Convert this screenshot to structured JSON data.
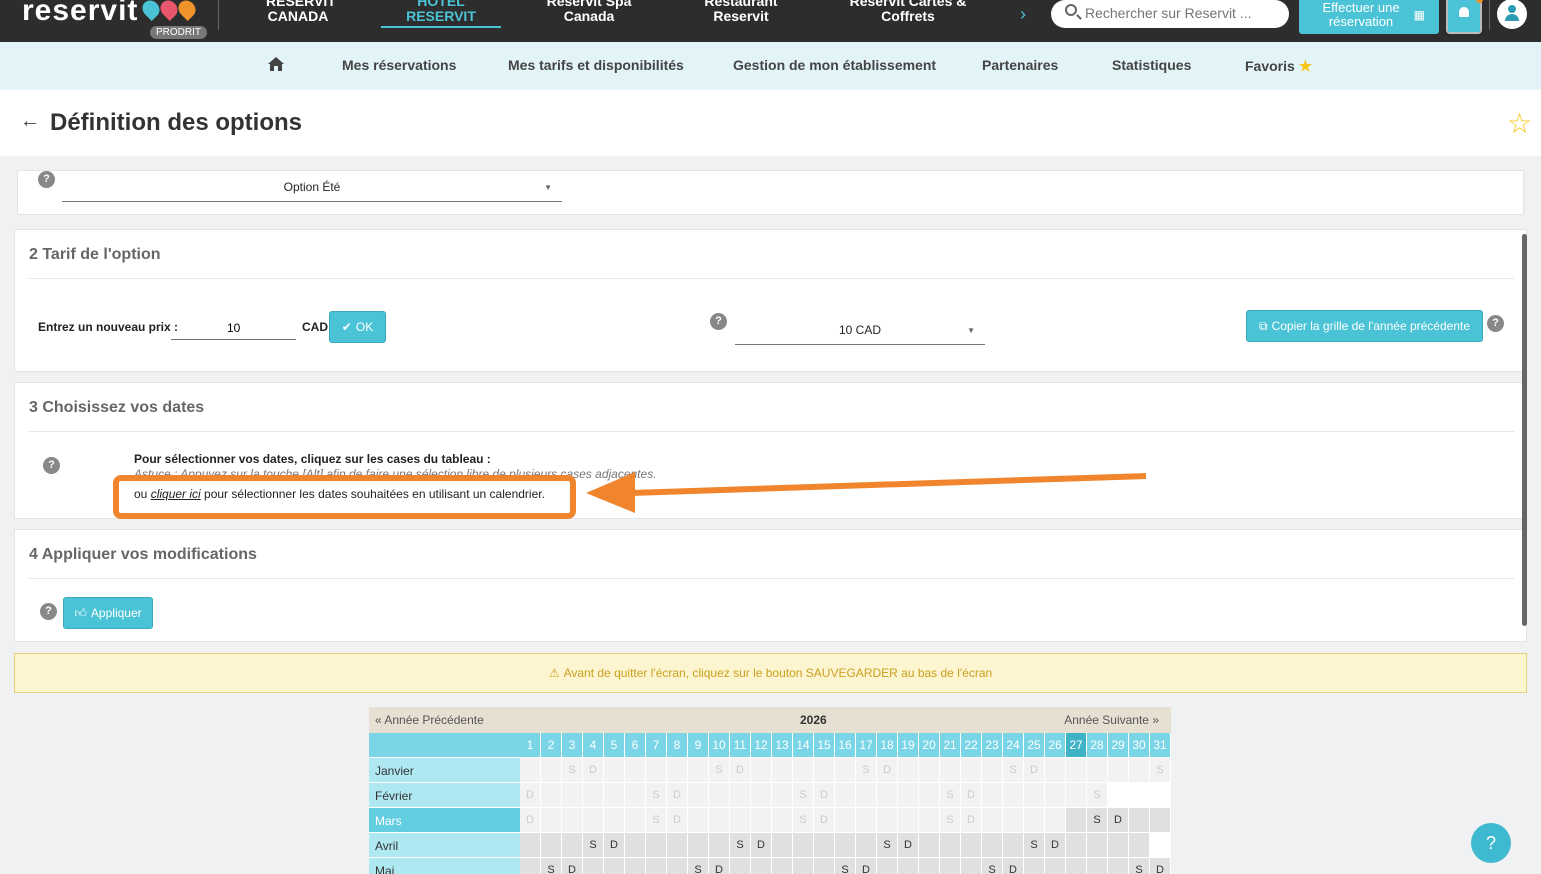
{
  "brand": {
    "logo": "reservit",
    "badge": "PRODRIT"
  },
  "topnav": [
    {
      "label": "RESERVIT CANADA"
    },
    {
      "label": "HOTEL RESERVIT"
    },
    {
      "label": "Reservit Spa Canada"
    },
    {
      "label": "Restaurant Reservit"
    },
    {
      "label": "Reservit Cartes & Coffrets"
    }
  ],
  "search": {
    "placeholder": "Rechercher sur Reservit ..."
  },
  "book_button": "Effectuer une réservation",
  "subnav": [
    "Mes réservations",
    "Mes tarifs et disponibilités",
    "Gestion de mon établissement",
    "Partenaires",
    "Statistiques",
    "Favoris"
  ],
  "page": {
    "title": "Définition des options"
  },
  "section1": {
    "option_select": "Option Été"
  },
  "section2": {
    "title": "2 Tarif de l'option",
    "price_label": "Entrez un nouveau prix :",
    "price_value": "10",
    "currency": "CAD",
    "ok": "OK",
    "price_select": "10 CAD",
    "copy_button": "Copier la grille de l'année précédente"
  },
  "section3": {
    "title": "3 Choisissez vos dates",
    "line1": "Pour sélectionner vos dates, cliquez sur les cases du tableau :",
    "line2": "Astuce : Appuyez sur la touche [Alt] afin de faire une sélection libre de plusieurs cases adjacentes.",
    "line3_prefix": "ou ",
    "line3_link": "cliquer ici",
    "line3_suffix": " pour sélectionner les dates souhaitées en utilisant un calendrier."
  },
  "section4": {
    "title": "4 Appliquer vos modifications",
    "apply": "Appliquer"
  },
  "warning": "Avant de quitter l'écran, cliquez sur le bouton SAUVEGARDER au bas de l'écran",
  "calendar": {
    "prev": "« Année Précédente",
    "year": "2026",
    "next": "Année Suivante »",
    "months": [
      {
        "name": "Janvier",
        "marks": {
          "3": "S",
          "4": "D",
          "10": "S",
          "11": "D",
          "17": "S",
          "18": "D",
          "24": "S",
          "25": "D",
          "31": "S"
        }
      },
      {
        "name": "Février",
        "marks": {
          "1": "D",
          "7": "S",
          "8": "D",
          "14": "S",
          "15": "D",
          "21": "S",
          "22": "D",
          "28": "S"
        }
      },
      {
        "name": "Mars",
        "marks": {
          "1": "D",
          "7": "S",
          "8": "D",
          "14": "S",
          "15": "D",
          "21": "S",
          "22": "D",
          "28": "S",
          "29": "D"
        }
      },
      {
        "name": "Avril",
        "marks": {
          "4": "S",
          "5": "D",
          "11": "S",
          "12": "D",
          "18": "S",
          "19": "D",
          "25": "S",
          "26": "D"
        }
      },
      {
        "name": "Mai",
        "marks": {
          "2": "S",
          "3": "D",
          "9": "S",
          "10": "D",
          "16": "S",
          "17": "D",
          "23": "S",
          "24": "D",
          "30": "S",
          "31": "D"
        }
      }
    ]
  },
  "colors": {
    "accent": "#4bc3d6",
    "highlight": "#f0852d",
    "warning_bg": "#fcf5cf"
  },
  "help_fab": "?"
}
